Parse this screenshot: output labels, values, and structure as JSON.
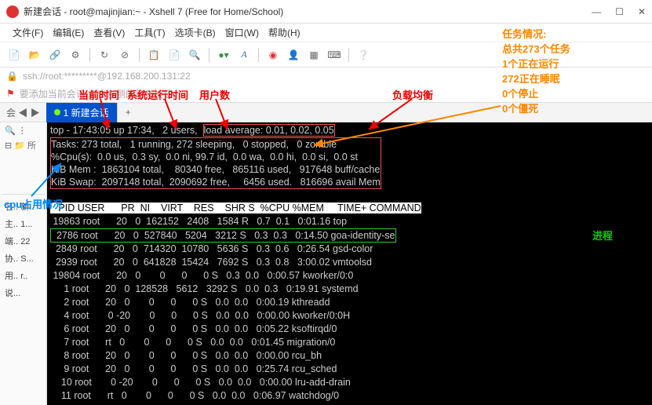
{
  "window": {
    "title": "新建会话 - root@majinjian:~ - Xshell 7 (Free for Home/School)"
  },
  "menu": {
    "file": "文件(F)",
    "edit": "编辑(E)",
    "view": "查看(V)",
    "tools": "工具(T)",
    "tabs": "选项卡(B)",
    "window": "窗口(W)",
    "help": "帮助(H)"
  },
  "address": "ssh://root:*********@192.168.200.131:22",
  "tip": "要添加当前会话,点击左侧的箭头按钮。",
  "tabsmall": "会 ◀ ▶",
  "tab": "1 新建会话",
  "sidebar": {
    "all": "所",
    "labels": [
      "名..",
      "主..",
      "端..",
      "协..",
      "用..",
      "说..."
    ],
    "vals": [
      "新..",
      "1...",
      "22",
      "S...",
      "r..",
      ""
    ]
  },
  "top": {
    "line1_a": "top - 17:43:05 up 17:34,   2 users,  ",
    "line1_b": "load average: 0.01, 0.02, 0.05",
    "tasks": "Tasks: 273 total,   1 running, 272 sleeping,   0 stopped,   0 zombie",
    "cpu": "%Cpu(s):  0.0 us,  0.3 sy,  0.0 ni, 99.7 id,  0.0 wa,  0.0 hi,  0.0 si,  0.0 st",
    "mem": "KiB Mem :  1863104 total,    80340 free,   865116 used,   917648 buff/cache",
    "swap": "KiB Swap:  2097148 total,  2090692 free,     6456 used.   816696 avail Mem"
  },
  "hdr": "   PID USER      PR  NI    VIRT    RES    SHR S  %CPU %MEM     TIME+ COMMAND",
  "rows": [
    " 19863 root      20   0  162152   2408   1584 R   0.7  0.1   0:01.16 top",
    "  2786 root      20   0  527840   5204   3212 S   0.3  0.3   0:14.50 goa-identity-se",
    "  2849 root      20   0  714320  10780   5636 S   0.3  0.6   0:26.54 gsd-color",
    "  2939 root      20   0  641828  15424   7692 S   0.3  0.8   3:00.02 vmtoolsd",
    " 19804 root      20   0       0      0      0 S   0.3  0.0   0:00.57 kworker/0:0",
    "     1 root      20   0  128528   5612   3292 S   0.0  0.3   0:19.91 systemd",
    "     2 root      20   0       0      0      0 S   0.0  0.0   0:00.19 kthreadd",
    "     4 root       0 -20       0      0      0 S   0.0  0.0   0:00.00 kworker/0:0H",
    "     6 root      20   0       0      0      0 S   0.0  0.0   0:05.22 ksoftirqd/0",
    "     7 root      rt   0       0      0      0 S   0.0  0.0   0:01.45 migration/0",
    "     8 root      20   0       0      0      0 S   0.0  0.0   0:00.00 rcu_bh",
    "     9 root      20   0       0      0      0 S   0.0  0.0   0:25.74 rcu_sched",
    "    10 root       0 -20       0      0      0 S   0.0  0.0   0:00.00 lru-add-drain",
    "    11 root      rt   0       0      0      0 S   0.0  0.0   0:06.97 watchdog/0"
  ],
  "annot": {
    "curtime": "当前时间",
    "uptime": "系统运行时间",
    "users": "用户数",
    "load": "负载均衡",
    "cpu": "cpu占用情况",
    "proc": "进程",
    "taskhdr": "任务情况:",
    "task1": "总共273个任务",
    "task2": "1个正在运行",
    "task3": "272正在睡眠",
    "task4": "0个停止",
    "task5": "0个僵死"
  }
}
